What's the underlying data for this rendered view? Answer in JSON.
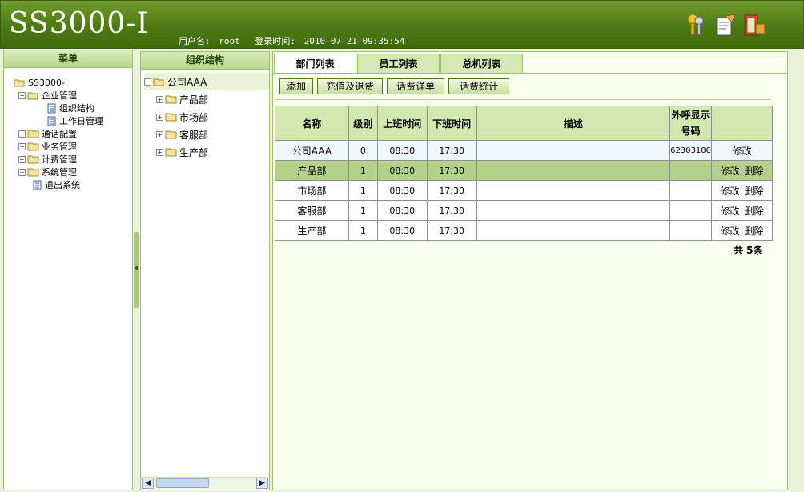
{
  "app": {
    "title": "SS3000-I",
    "user_label": "用户名:",
    "user": "root",
    "login_label": "登录时间:",
    "login_time": "2010-07-21 09:35:54",
    "header_icons": [
      "keys-icon",
      "edit-note-icon",
      "exit-door-icon"
    ]
  },
  "menu": {
    "title": "菜单",
    "root": "SS3000-I",
    "items": [
      {
        "label": "企业管理",
        "children": [
          "组织结构",
          "工作日管理"
        ]
      },
      {
        "label": "通话配置"
      },
      {
        "label": "业务管理"
      },
      {
        "label": "计费管理"
      },
      {
        "label": "系统管理"
      },
      {
        "label": "退出系统"
      }
    ]
  },
  "org": {
    "title": "组织结构",
    "root": "公司AAA",
    "departments": [
      "产品部",
      "市场部",
      "客服部",
      "生产部"
    ]
  },
  "tabs": [
    "部门列表",
    "员工列表",
    "总机列表"
  ],
  "actions": [
    "添加",
    "充值及退费",
    "话费详单",
    "话费统计"
  ],
  "table": {
    "headers": [
      "名称",
      "级别",
      "上班时间",
      "下班时间",
      "描述",
      "外呼显示号码",
      ""
    ],
    "rows": [
      {
        "name": "公司AAA",
        "level": "0",
        "start": "08:30",
        "end": "17:30",
        "desc": "",
        "callerid": "62303100",
        "edit": "修改",
        "delete": ""
      },
      {
        "name": "产品部",
        "level": "1",
        "start": "08:30",
        "end": "17:30",
        "desc": "",
        "callerid": "",
        "edit": "修改",
        "delete": "删除"
      },
      {
        "name": "市场部",
        "level": "1",
        "start": "08:30",
        "end": "17:30",
        "desc": "",
        "callerid": "",
        "edit": "修改",
        "delete": "删除"
      },
      {
        "name": "客服部",
        "level": "1",
        "start": "08:30",
        "end": "17:30",
        "desc": "",
        "callerid": "",
        "edit": "修改",
        "delete": "删除"
      },
      {
        "name": "生产部",
        "level": "1",
        "start": "08:30",
        "end": "17:30",
        "desc": "",
        "callerid": "",
        "edit": "修改",
        "delete": "删除"
      }
    ],
    "total": "共 5条"
  },
  "colors": {
    "header_green": "#4e7a14",
    "panel_bg": "#e9f3d6",
    "selected_row": "#b3d18a"
  }
}
